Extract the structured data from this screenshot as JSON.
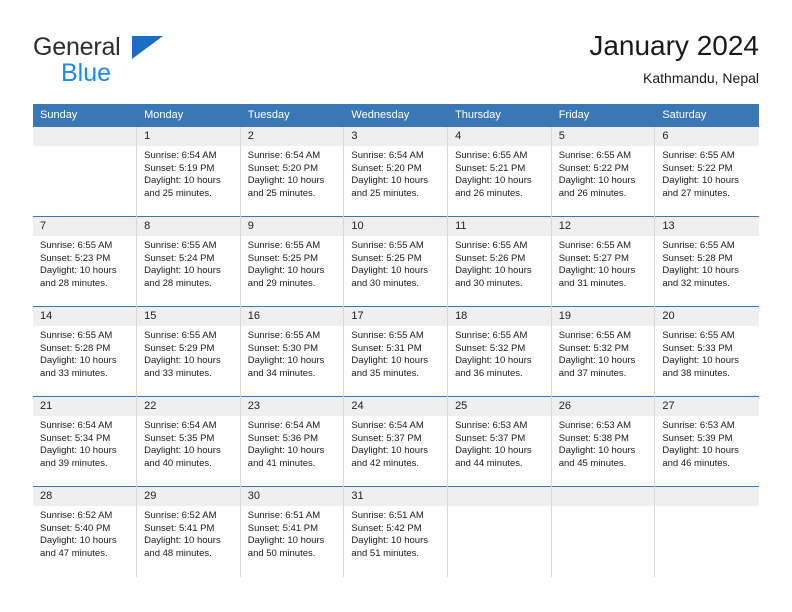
{
  "brand": {
    "name_top": "General",
    "name_bottom": "Blue",
    "triangle_color": "#1a6fc4",
    "blue_color": "#1e8ae0"
  },
  "header": {
    "title": "January 2024",
    "subtitle": "Kathmandu, Nepal"
  },
  "theme": {
    "header_row_bg": "#3a78b5",
    "header_row_text": "#ffffff",
    "daynum_bg": "#efefef",
    "cell_bg": "#ffffff",
    "grid_line": "#d8d8d8"
  },
  "weekdays": [
    "Sunday",
    "Monday",
    "Tuesday",
    "Wednesday",
    "Thursday",
    "Friday",
    "Saturday"
  ],
  "weeks": [
    [
      {
        "day": "",
        "sunrise": "",
        "sunset": "",
        "daylight_line1": "",
        "daylight_line2": ""
      },
      {
        "day": "1",
        "sunrise": "Sunrise: 6:54 AM",
        "sunset": "Sunset: 5:19 PM",
        "daylight_line1": "Daylight: 10 hours",
        "daylight_line2": "and 25 minutes."
      },
      {
        "day": "2",
        "sunrise": "Sunrise: 6:54 AM",
        "sunset": "Sunset: 5:20 PM",
        "daylight_line1": "Daylight: 10 hours",
        "daylight_line2": "and 25 minutes."
      },
      {
        "day": "3",
        "sunrise": "Sunrise: 6:54 AM",
        "sunset": "Sunset: 5:20 PM",
        "daylight_line1": "Daylight: 10 hours",
        "daylight_line2": "and 25 minutes."
      },
      {
        "day": "4",
        "sunrise": "Sunrise: 6:55 AM",
        "sunset": "Sunset: 5:21 PM",
        "daylight_line1": "Daylight: 10 hours",
        "daylight_line2": "and 26 minutes."
      },
      {
        "day": "5",
        "sunrise": "Sunrise: 6:55 AM",
        "sunset": "Sunset: 5:22 PM",
        "daylight_line1": "Daylight: 10 hours",
        "daylight_line2": "and 26 minutes."
      },
      {
        "day": "6",
        "sunrise": "Sunrise: 6:55 AM",
        "sunset": "Sunset: 5:22 PM",
        "daylight_line1": "Daylight: 10 hours",
        "daylight_line2": "and 27 minutes."
      }
    ],
    [
      {
        "day": "7",
        "sunrise": "Sunrise: 6:55 AM",
        "sunset": "Sunset: 5:23 PM",
        "daylight_line1": "Daylight: 10 hours",
        "daylight_line2": "and 28 minutes."
      },
      {
        "day": "8",
        "sunrise": "Sunrise: 6:55 AM",
        "sunset": "Sunset: 5:24 PM",
        "daylight_line1": "Daylight: 10 hours",
        "daylight_line2": "and 28 minutes."
      },
      {
        "day": "9",
        "sunrise": "Sunrise: 6:55 AM",
        "sunset": "Sunset: 5:25 PM",
        "daylight_line1": "Daylight: 10 hours",
        "daylight_line2": "and 29 minutes."
      },
      {
        "day": "10",
        "sunrise": "Sunrise: 6:55 AM",
        "sunset": "Sunset: 5:25 PM",
        "daylight_line1": "Daylight: 10 hours",
        "daylight_line2": "and 30 minutes."
      },
      {
        "day": "11",
        "sunrise": "Sunrise: 6:55 AM",
        "sunset": "Sunset: 5:26 PM",
        "daylight_line1": "Daylight: 10 hours",
        "daylight_line2": "and 30 minutes."
      },
      {
        "day": "12",
        "sunrise": "Sunrise: 6:55 AM",
        "sunset": "Sunset: 5:27 PM",
        "daylight_line1": "Daylight: 10 hours",
        "daylight_line2": "and 31 minutes."
      },
      {
        "day": "13",
        "sunrise": "Sunrise: 6:55 AM",
        "sunset": "Sunset: 5:28 PM",
        "daylight_line1": "Daylight: 10 hours",
        "daylight_line2": "and 32 minutes."
      }
    ],
    [
      {
        "day": "14",
        "sunrise": "Sunrise: 6:55 AM",
        "sunset": "Sunset: 5:28 PM",
        "daylight_line1": "Daylight: 10 hours",
        "daylight_line2": "and 33 minutes."
      },
      {
        "day": "15",
        "sunrise": "Sunrise: 6:55 AM",
        "sunset": "Sunset: 5:29 PM",
        "daylight_line1": "Daylight: 10 hours",
        "daylight_line2": "and 33 minutes."
      },
      {
        "day": "16",
        "sunrise": "Sunrise: 6:55 AM",
        "sunset": "Sunset: 5:30 PM",
        "daylight_line1": "Daylight: 10 hours",
        "daylight_line2": "and 34 minutes."
      },
      {
        "day": "17",
        "sunrise": "Sunrise: 6:55 AM",
        "sunset": "Sunset: 5:31 PM",
        "daylight_line1": "Daylight: 10 hours",
        "daylight_line2": "and 35 minutes."
      },
      {
        "day": "18",
        "sunrise": "Sunrise: 6:55 AM",
        "sunset": "Sunset: 5:32 PM",
        "daylight_line1": "Daylight: 10 hours",
        "daylight_line2": "and 36 minutes."
      },
      {
        "day": "19",
        "sunrise": "Sunrise: 6:55 AM",
        "sunset": "Sunset: 5:32 PM",
        "daylight_line1": "Daylight: 10 hours",
        "daylight_line2": "and 37 minutes."
      },
      {
        "day": "20",
        "sunrise": "Sunrise: 6:55 AM",
        "sunset": "Sunset: 5:33 PM",
        "daylight_line1": "Daylight: 10 hours",
        "daylight_line2": "and 38 minutes."
      }
    ],
    [
      {
        "day": "21",
        "sunrise": "Sunrise: 6:54 AM",
        "sunset": "Sunset: 5:34 PM",
        "daylight_line1": "Daylight: 10 hours",
        "daylight_line2": "and 39 minutes."
      },
      {
        "day": "22",
        "sunrise": "Sunrise: 6:54 AM",
        "sunset": "Sunset: 5:35 PM",
        "daylight_line1": "Daylight: 10 hours",
        "daylight_line2": "and 40 minutes."
      },
      {
        "day": "23",
        "sunrise": "Sunrise: 6:54 AM",
        "sunset": "Sunset: 5:36 PM",
        "daylight_line1": "Daylight: 10 hours",
        "daylight_line2": "and 41 minutes."
      },
      {
        "day": "24",
        "sunrise": "Sunrise: 6:54 AM",
        "sunset": "Sunset: 5:37 PM",
        "daylight_line1": "Daylight: 10 hours",
        "daylight_line2": "and 42 minutes."
      },
      {
        "day": "25",
        "sunrise": "Sunrise: 6:53 AM",
        "sunset": "Sunset: 5:37 PM",
        "daylight_line1": "Daylight: 10 hours",
        "daylight_line2": "and 44 minutes."
      },
      {
        "day": "26",
        "sunrise": "Sunrise: 6:53 AM",
        "sunset": "Sunset: 5:38 PM",
        "daylight_line1": "Daylight: 10 hours",
        "daylight_line2": "and 45 minutes."
      },
      {
        "day": "27",
        "sunrise": "Sunrise: 6:53 AM",
        "sunset": "Sunset: 5:39 PM",
        "daylight_line1": "Daylight: 10 hours",
        "daylight_line2": "and 46 minutes."
      }
    ],
    [
      {
        "day": "28",
        "sunrise": "Sunrise: 6:52 AM",
        "sunset": "Sunset: 5:40 PM",
        "daylight_line1": "Daylight: 10 hours",
        "daylight_line2": "and 47 minutes."
      },
      {
        "day": "29",
        "sunrise": "Sunrise: 6:52 AM",
        "sunset": "Sunset: 5:41 PM",
        "daylight_line1": "Daylight: 10 hours",
        "daylight_line2": "and 48 minutes."
      },
      {
        "day": "30",
        "sunrise": "Sunrise: 6:51 AM",
        "sunset": "Sunset: 5:41 PM",
        "daylight_line1": "Daylight: 10 hours",
        "daylight_line2": "and 50 minutes."
      },
      {
        "day": "31",
        "sunrise": "Sunrise: 6:51 AM",
        "sunset": "Sunset: 5:42 PM",
        "daylight_line1": "Daylight: 10 hours",
        "daylight_line2": "and 51 minutes."
      },
      {
        "day": "",
        "sunrise": "",
        "sunset": "",
        "daylight_line1": "",
        "daylight_line2": ""
      },
      {
        "day": "",
        "sunrise": "",
        "sunset": "",
        "daylight_line1": "",
        "daylight_line2": ""
      },
      {
        "day": "",
        "sunrise": "",
        "sunset": "",
        "daylight_line1": "",
        "daylight_line2": ""
      }
    ]
  ]
}
